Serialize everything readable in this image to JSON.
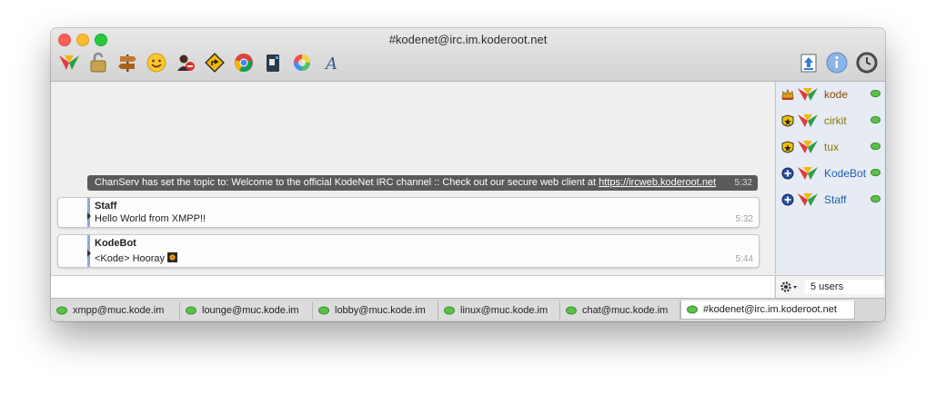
{
  "window": {
    "title": "#kodenet@irc.im.koderoot.net"
  },
  "toolbar": {
    "icons": [
      "kode-logo-icon",
      "lock-icon",
      "signpost-icon",
      "smiley-icon",
      "user-ban-icon",
      "direction-sign-icon",
      "chrome-icon",
      "phone-book-icon",
      "color-wheel-icon",
      "font-icon"
    ],
    "right_icons": [
      "upload-icon",
      "info-icon",
      "clock-icon"
    ]
  },
  "chat": {
    "topic": {
      "text": "ChanServ has set the topic to: Welcome to the official KodeNet IRC channel :: Check out our secure web client at ",
      "url": "https://ircweb.koderoot.net",
      "time": "5:32"
    },
    "messages": [
      {
        "nick": "Staff",
        "text": "Hello World from XMPP!!",
        "time": "5:32"
      },
      {
        "nick": "KodeBot",
        "text": "<Kode> Hooray",
        "time": "5:44"
      }
    ]
  },
  "users": [
    {
      "name": "kode",
      "rank": "crown",
      "color": "#8a4b00"
    },
    {
      "name": "cirkit",
      "rank": "star",
      "color": "#8a7a00"
    },
    {
      "name": "tux",
      "rank": "star",
      "color": "#8a7a00"
    },
    {
      "name": "KodeBot",
      "rank": "voice",
      "color": "#1f5fb0"
    },
    {
      "name": "Staff",
      "rank": "voice",
      "color": "#1f5fb0"
    }
  ],
  "userlist_footer": {
    "count": "5 users"
  },
  "tabs": [
    {
      "label": "xmpp@muc.kode.im"
    },
    {
      "label": "lounge@muc.kode.im"
    },
    {
      "label": "lobby@muc.kode.im"
    },
    {
      "label": "linux@muc.kode.im"
    },
    {
      "label": "chat@muc.kode.im"
    },
    {
      "label": "#kodenet@irc.im.koderoot.net"
    }
  ]
}
